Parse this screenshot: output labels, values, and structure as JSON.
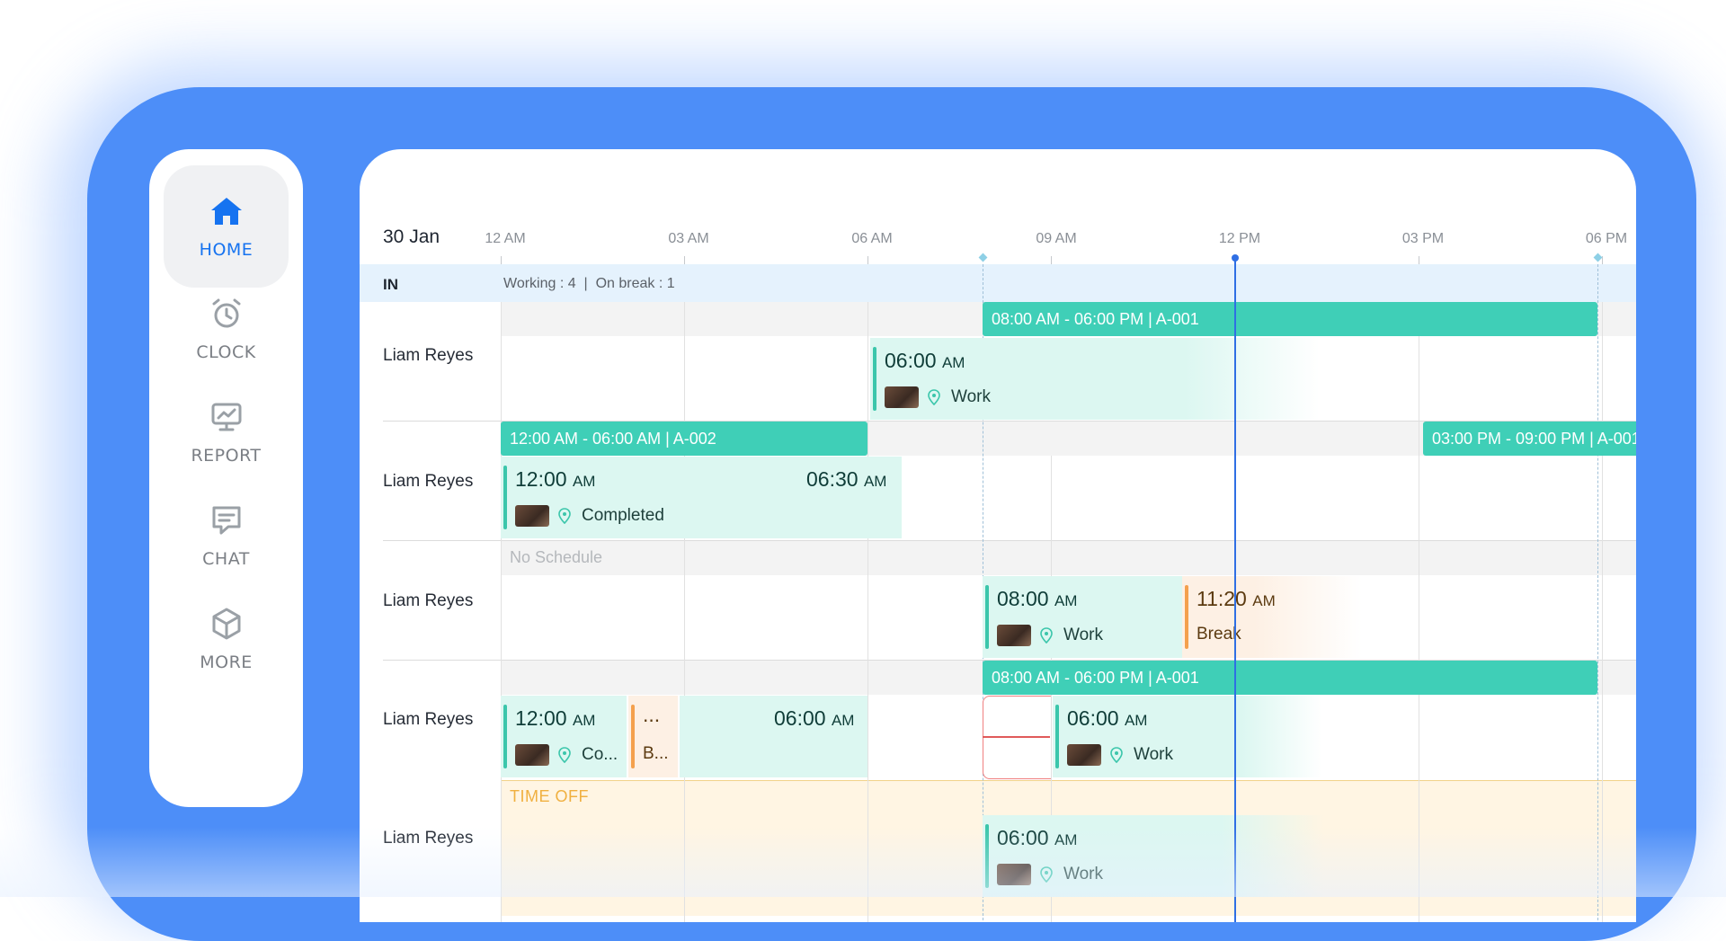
{
  "sidebar": {
    "items": [
      {
        "label": "HOME",
        "icon": "home-icon",
        "active": true
      },
      {
        "label": "CLOCK",
        "icon": "alarm-clock-icon",
        "active": false
      },
      {
        "label": "REPORT",
        "icon": "report-icon",
        "active": false
      },
      {
        "label": "CHAT",
        "icon": "chat-icon",
        "active": false
      },
      {
        "label": "MORE",
        "icon": "cube-icon",
        "active": false
      }
    ]
  },
  "timeline": {
    "date": "30 Jan",
    "ticks": [
      "12 AM",
      "03 AM",
      "06 AM",
      "09 AM",
      "12 PM",
      "03 PM",
      "06 PM"
    ]
  },
  "summary": {
    "status": "IN",
    "stats": "Working : 4  |  On break : 1"
  },
  "rows": [
    {
      "name": "Liam Reyes",
      "schedule": "08:00 AM - 06:00 PM | A-001",
      "cards": [
        {
          "time": "06:00",
          "ampm": "AM",
          "label": "Work"
        }
      ]
    },
    {
      "name": "Liam Reyes",
      "schedule": "12:00 AM - 06:00 AM | A-002",
      "schedule2": "03:00 PM - 09:00 PM | A-001",
      "cards": [
        {
          "time": "12:00",
          "ampm": "AM",
          "end_time": "06:30",
          "end_ampm": "AM",
          "label": "Completed"
        }
      ]
    },
    {
      "name": "Liam Reyes",
      "no_schedule": "No Schedule",
      "cards": [
        {
          "time": "08:00",
          "ampm": "AM",
          "label": "Work"
        },
        {
          "time": "11:20",
          "ampm": "AM",
          "label": "Break"
        }
      ]
    },
    {
      "name": "Liam Reyes",
      "schedule": "08:00 AM - 06:00 PM | A-001",
      "cards": [
        {
          "time": "12:00",
          "ampm": "AM",
          "label": "Co..."
        },
        {
          "time": "...",
          "label": "B..."
        },
        {
          "time": "06:00",
          "ampm": "AM"
        },
        {
          "time": "06:00",
          "ampm": "AM",
          "label": "Work"
        }
      ]
    },
    {
      "name": "Liam Reyes",
      "time_off": "TIME OFF",
      "cards": [
        {
          "time": "06:00",
          "ampm": "AM",
          "label": "Work"
        }
      ]
    }
  ],
  "colors": {
    "frame": "#4d8ef8",
    "accent": "#1673f0",
    "schedule": "#3fcfb7",
    "card": "#dcf7f1",
    "break": "#f4a04d",
    "now": "#2f6fe4"
  }
}
